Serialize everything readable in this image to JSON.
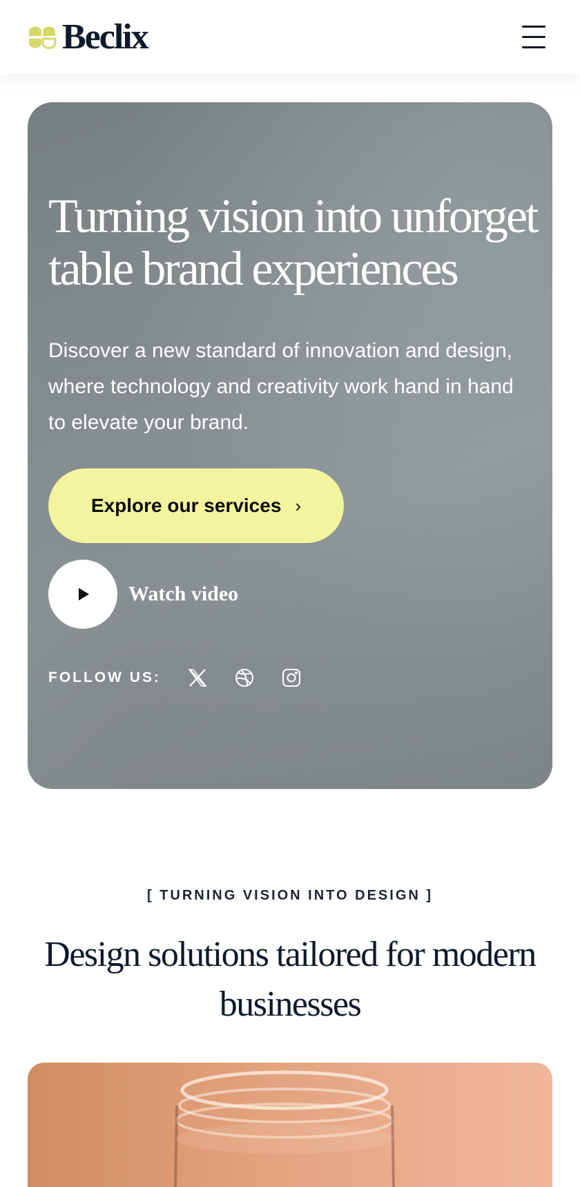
{
  "header": {
    "brand_name": "Beclix",
    "logo_icon": "beclix-logo-mark",
    "menu_icon": "hamburger-menu-icon"
  },
  "hero": {
    "title": "Turning vision into unforgettable brand experiences",
    "description": "Discover a new standard of innovation and design, where technology and creativity work hand in hand to elevate your brand.",
    "cta_label": "Explore our services",
    "cta_icon": "chevron-right-icon",
    "watch_label": "Watch video",
    "play_icon": "play-icon",
    "follow_label": "FOLLOW US:",
    "social": [
      "x-twitter-icon",
      "dribbble-icon",
      "instagram-icon"
    ]
  },
  "section": {
    "eyebrow": "[ TURNING VISION INTO DESIGN ]",
    "title": "Design solutions tailored for modern businesses"
  },
  "colors": {
    "accent": "#f3f59e",
    "logo_accent": "#d6d96a",
    "dark_text": "#0e1a2b",
    "hero_bg": "#8a9294"
  }
}
